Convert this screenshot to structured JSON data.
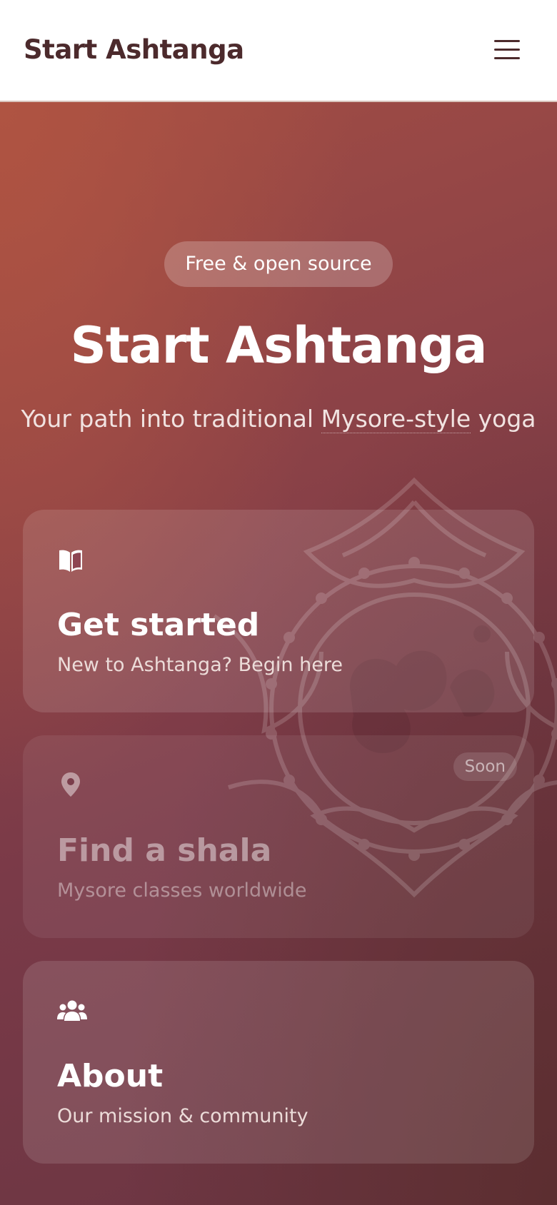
{
  "header": {
    "brand": "Start Ashtanga",
    "menu_icon": "hamburger-menu-icon"
  },
  "hero": {
    "pill": "Free & open source",
    "title": "Start Ashtanga",
    "subtitle_before": "Your path into traditional ",
    "subtitle_term": "Mysore-style",
    "subtitle_after": " yoga"
  },
  "cards": [
    {
      "icon": "book-icon",
      "title": "Get started",
      "description": "New to Ashtanga? Begin here"
    },
    {
      "icon": "map-pin-icon",
      "title": "Find a shala",
      "description": "Mysore classes worldwide",
      "badge": "Soon"
    },
    {
      "icon": "users-icon",
      "title": "About",
      "description": "Our mission & community"
    }
  ],
  "colors": {
    "brand_text": "#4c2a2c",
    "hero_gradient_start": "#a24d44",
    "hero_gradient_end": "#6a3542"
  }
}
